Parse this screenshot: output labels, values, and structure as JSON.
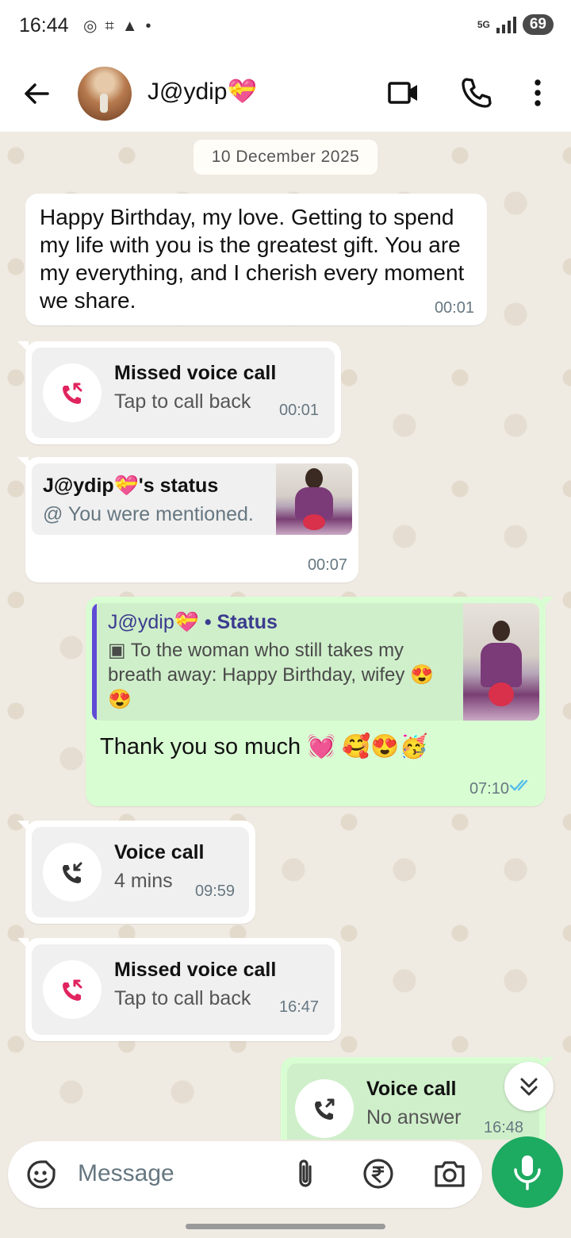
{
  "statusbar": {
    "time": "16:44",
    "network": "5G",
    "battery": "69"
  },
  "header": {
    "contact_name": "J@ydip💝"
  },
  "chat": {
    "date_chip": "10 December 2025",
    "messages": [
      {
        "text": "Happy Birthday, my love. Getting to spend my life with you is the greatest gift. You are my everything, and I cherish every moment we share.",
        "time": "00:01"
      },
      {
        "title": "Missed voice call",
        "subtitle": "Tap to call back",
        "time": "00:01"
      },
      {
        "title": "J@ydip💝's status",
        "subtitle": "You were mentioned.",
        "at": "@",
        "time": "00:07"
      },
      {
        "quote_name": "J@ydip💝",
        "quote_source": "• Status",
        "quote_text": "To the woman who still takes my breath away: Happy Birthday, wifey 😍😍",
        "text": "Thank you so much 💓 🥰😍🥳",
        "time": "07:10"
      },
      {
        "title": "Voice call",
        "subtitle": "4 mins",
        "time": "09:59"
      },
      {
        "title": "Missed voice call",
        "subtitle": "Tap to call back",
        "time": "16:47"
      },
      {
        "title": "Voice call",
        "subtitle": "No answer",
        "time": "16:48"
      }
    ]
  },
  "composer": {
    "placeholder": "Message"
  },
  "colors": {
    "outgoing": "#d9fdd3",
    "missed_call": "#e0245e",
    "accent": "#1daa61",
    "read_ticks": "#53bdeb"
  },
  "icons": [
    "back-arrow-icon",
    "video-call-icon",
    "phone-icon",
    "more-vert-icon",
    "missed-call-icon",
    "outgoing-call-icon",
    "double-check-icon",
    "sticker-icon",
    "attach-icon",
    "rupee-icon",
    "camera-icon",
    "mic-icon",
    "double-chevron-down-icon"
  ]
}
